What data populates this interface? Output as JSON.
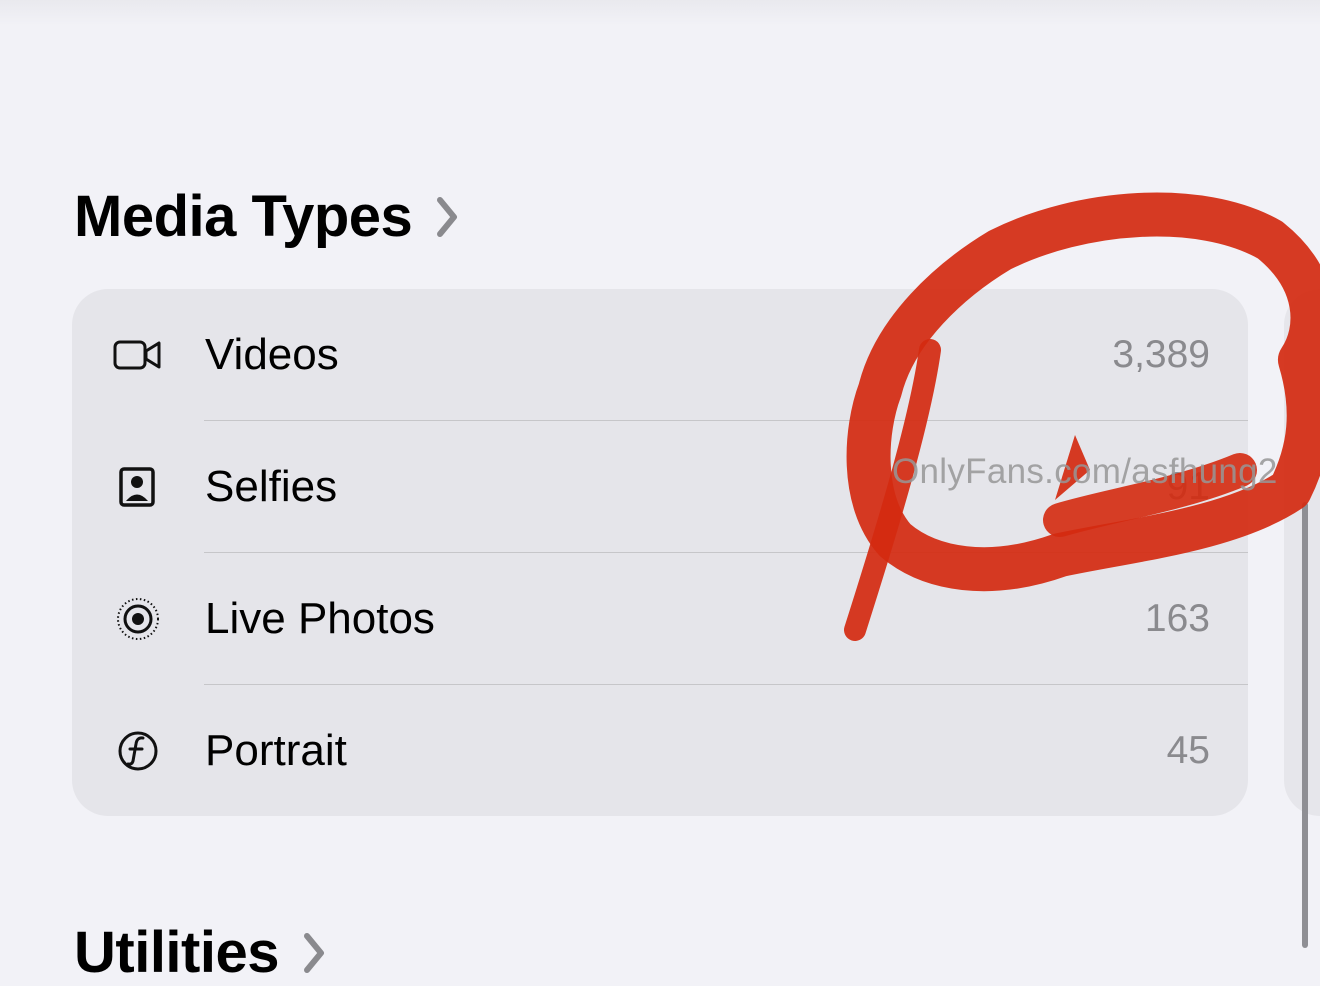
{
  "sections": {
    "media_types": {
      "title": "Media Types"
    },
    "utilities": {
      "title": "Utilities"
    }
  },
  "media_rows": [
    {
      "label": "Videos",
      "count": "3,389",
      "icon": "video-camera-icon"
    },
    {
      "label": "Selfies",
      "count": "91",
      "icon": "portrait-selfie-icon"
    },
    {
      "label": "Live Photos",
      "count": "163",
      "icon": "live-photo-icon"
    },
    {
      "label": "Portrait",
      "count": "45",
      "icon": "f-aperture-icon"
    }
  ],
  "overlay": {
    "watermark": "OnlyFans.com/asfhung2"
  },
  "colors": {
    "background": "#f2f2f7",
    "card": "#e5e5ea",
    "count_text": "#8a8a8e",
    "scribble": "#d42a10"
  }
}
